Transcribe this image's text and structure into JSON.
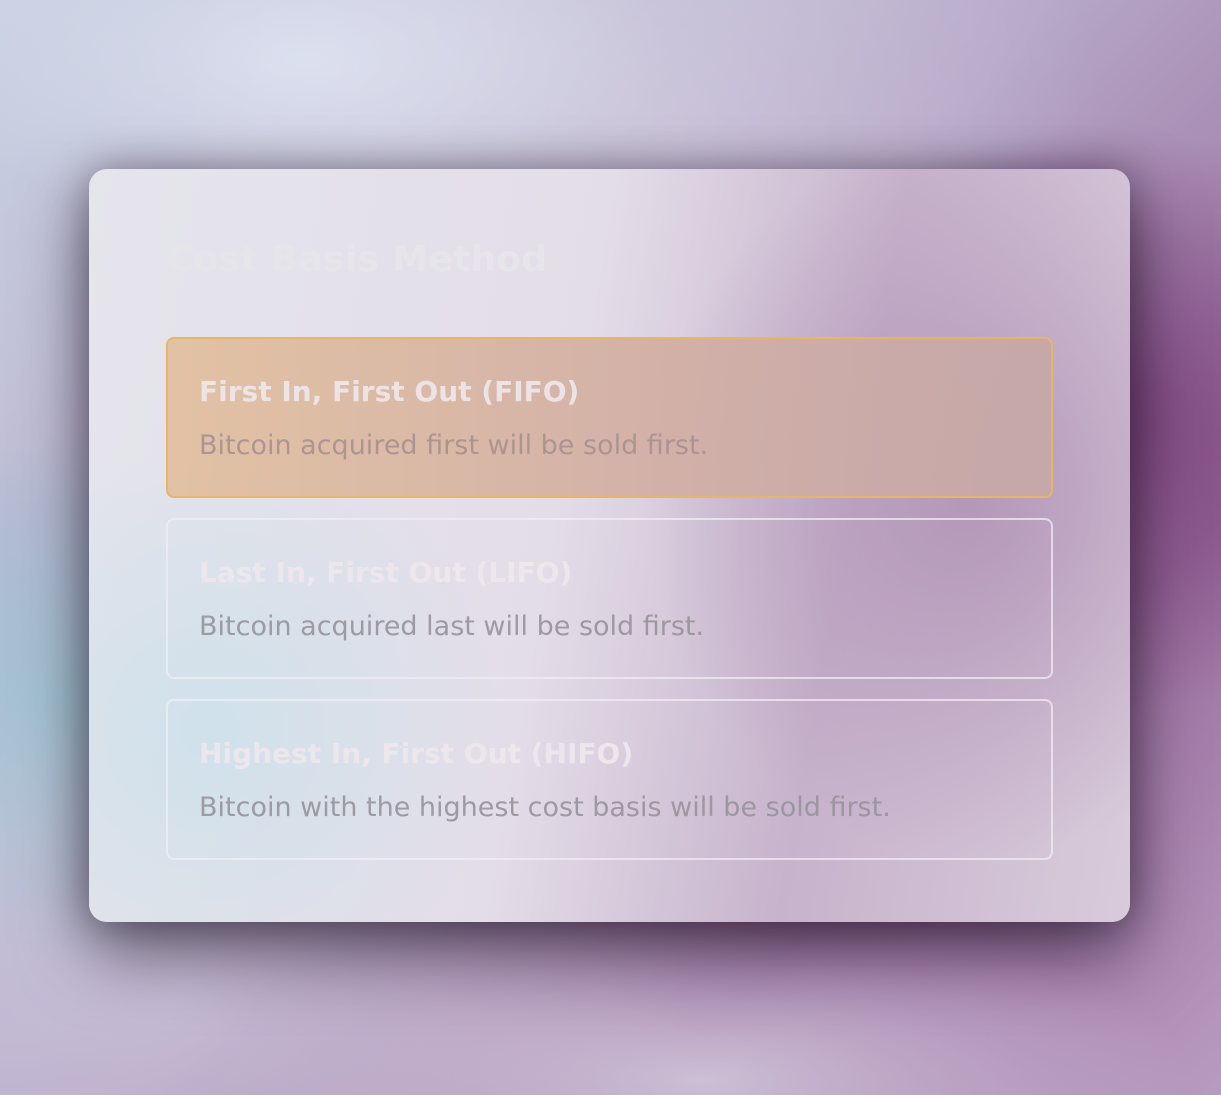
{
  "dialog": {
    "title": "Cost Basis Method",
    "options": [
      {
        "title": "First In, First Out (FIFO)",
        "description": "Bitcoin acquired first will be sold first.",
        "selected": true
      },
      {
        "title": "Last In, First Out (LIFO)",
        "description": "Bitcoin acquired last will be sold first.",
        "selected": false
      },
      {
        "title": "Highest In, First Out (HIFO)",
        "description": "Bitcoin with the highest cost basis will be sold first.",
        "selected": false
      }
    ]
  },
  "colors": {
    "selected_border": "#e6b56a",
    "selected_fill": "#dcbca2"
  }
}
